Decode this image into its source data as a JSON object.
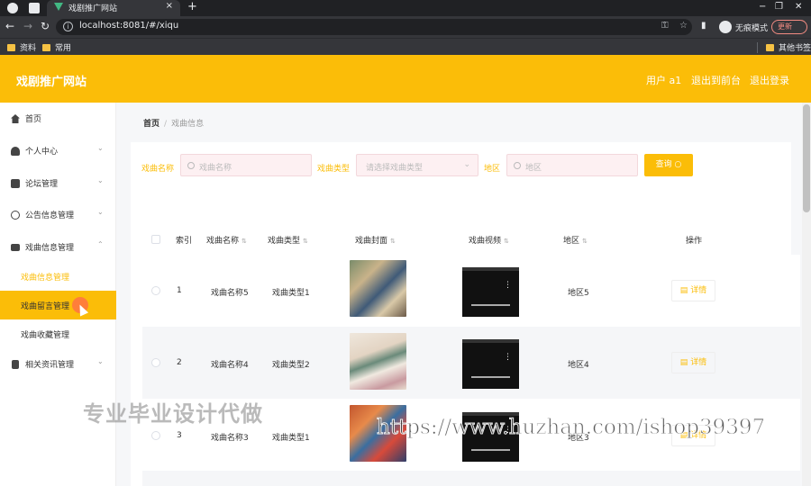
{
  "browser": {
    "tab_title": "戏剧推广网站",
    "tab_close": "×",
    "new_tab": "+",
    "url": "localhost:8081/#/xiqu",
    "incognito_label": "无痕模式",
    "update_label": "更新",
    "win_controls": [
      "−",
      "❐",
      "✕"
    ],
    "bookmarks": [
      "资料",
      "常用"
    ],
    "other_bookmarks": "其他书签"
  },
  "header": {
    "title": "戏剧推广网站",
    "user": "用户 a1",
    "back_to_admin": "退出到前台",
    "logout": "退出登录"
  },
  "sidebar": {
    "items": [
      {
        "label": "首页",
        "icon": "home-icon"
      },
      {
        "label": "个人中心",
        "icon": "user-icon",
        "arrow": "⌄"
      },
      {
        "label": "论坛管理",
        "icon": "chat-icon",
        "arrow": "⌄"
      },
      {
        "label": "公告信息管理",
        "icon": "clock-icon",
        "arrow": "⌄"
      },
      {
        "label": "戏曲信息管理",
        "icon": "monitor-icon",
        "arrow": "⌃"
      },
      {
        "label": "相关资讯管理",
        "icon": "doc-icon",
        "arrow": "⌄"
      }
    ],
    "submenu": [
      {
        "label": "戏曲信息管理"
      },
      {
        "label": "戏曲留言管理"
      },
      {
        "label": "戏曲收藏管理"
      }
    ]
  },
  "breadcrumb": {
    "home": "首页",
    "sep": "/",
    "current": "戏曲信息"
  },
  "filters": {
    "name_label": "戏曲名称",
    "name_placeholder": "戏曲名称",
    "type_label": "戏曲类型",
    "type_placeholder": "请选择戏曲类型",
    "area_label": "地区",
    "area_placeholder": "地区",
    "query_label": "查询"
  },
  "table": {
    "columns": [
      "索引",
      "戏曲名称",
      "戏曲类型",
      "戏曲封面",
      "戏曲视频",
      "地区",
      "操作"
    ],
    "rows": [
      {
        "index": "1",
        "name": "戏曲名称5",
        "type": "戏曲类型1",
        "area": "地区5",
        "action": "详情"
      },
      {
        "index": "2",
        "name": "戏曲名称4",
        "type": "戏曲类型2",
        "area": "地区4",
        "action": "详情"
      },
      {
        "index": "3",
        "name": "戏曲名称3",
        "type": "戏曲类型1",
        "area": "地区3",
        "action": "详情"
      }
    ]
  },
  "watermarks": {
    "cn": "专业毕业设计代做",
    "url": "https://www.huzhan.com/ishop39397"
  },
  "colors": {
    "accent": "#fbbd08",
    "chrome": "#35363a"
  }
}
